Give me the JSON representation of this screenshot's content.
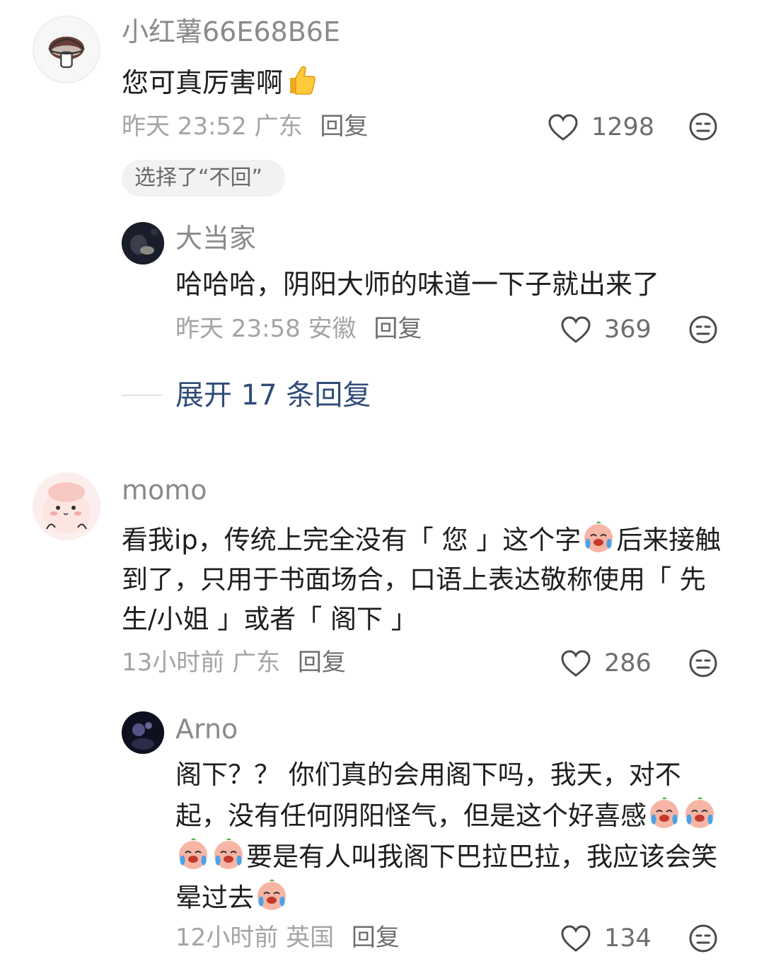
{
  "comments": [
    {
      "username": "小红薯66E68B6E",
      "text": "您可真厉害啊",
      "emoji": "thumbs-up-icon",
      "time": "昨天 23:52",
      "location": "广东",
      "reply_label": "回复",
      "likes": "1298"
    },
    {
      "username": "大当家",
      "text": "哈哈哈，阴阳大师的味道一下子就出来了",
      "time": "昨天 23:58",
      "location": "安徽",
      "reply_label": "回复",
      "likes": "369"
    },
    {
      "username": "momo",
      "text_a": "看我ip，传统上完全没有「 您 」这个字",
      "text_b": "后来接触到了，只用于书面场合，口语上表达敬称使用「 先生/小姐 」或者「 阁下 」",
      "time": "13小时前",
      "location": "广东",
      "reply_label": "回复",
      "likes": "286"
    },
    {
      "username": "Arno",
      "text_a": "阁下？？ 你们真的会用阁下吗，我天，对不起，没有任何阴阳怪气，但是这个好喜感",
      "text_b": "要是有人叫我阁下巴拉巴拉，我应该会笑晕过去",
      "time": "12小时前",
      "location": "英国",
      "reply_label": "回复",
      "likes": "134"
    }
  ],
  "chip_label": "选择了“不回”",
  "expand_label": "展开 17 条回复",
  "colors": {
    "username": "#8a8a8a",
    "meta": "#a4a4a4",
    "expand_link": "#2f4c78",
    "chip_bg": "#f2f2f2"
  }
}
